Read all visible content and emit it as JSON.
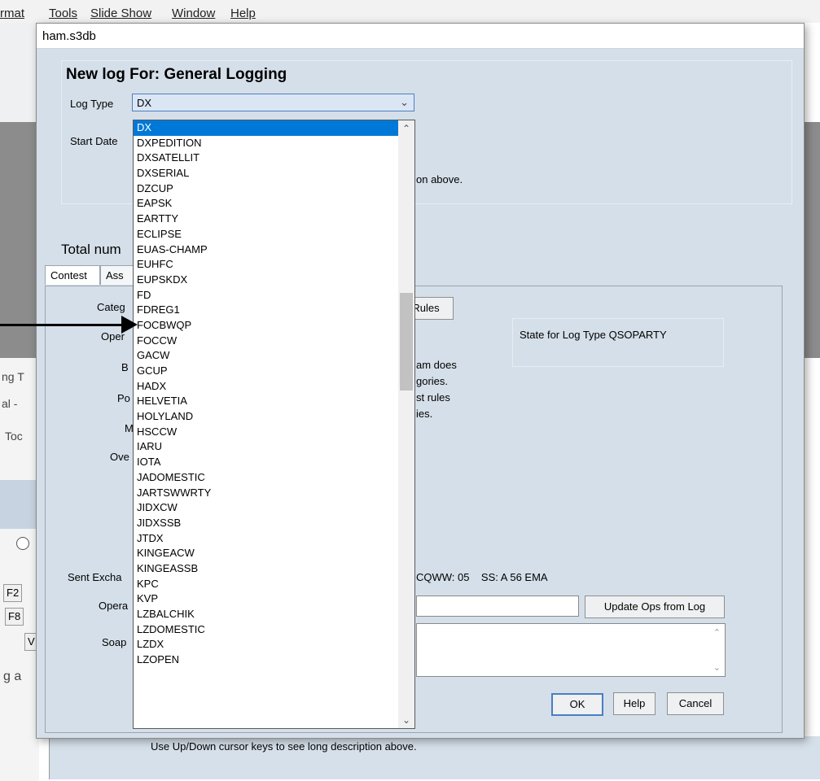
{
  "app_menu": {
    "items": [
      "rmat",
      "Tools",
      "Slide Show",
      "Window",
      "Help"
    ]
  },
  "background": {
    "left_fragments": [
      "ng T",
      "al -",
      "Toc",
      "F2",
      "F8",
      "V",
      "g  a"
    ],
    "bottom_hint": "Use Up/Down cursor keys to see long description above."
  },
  "dialog": {
    "window_title": "ham.s3db",
    "heading": "New log For: General Logging",
    "log_type_label": "Log Type",
    "log_type_value": "DX",
    "start_date_label": "Start Date",
    "description_fragment": "on above.",
    "total_label": "Total num",
    "tabs": [
      "Contest",
      "Ass"
    ],
    "rules_button": "Rules",
    "state_label": "State for Log Type QSOPARTY",
    "field_labels": {
      "category": "Categ",
      "operator": "Oper",
      "band": "B",
      "power": "Po",
      "mode": "M",
      "overlay": "Ove",
      "sent_exchange": "Sent Excha",
      "operators": "Opera",
      "soapbox": "Soap"
    },
    "info_lines": [
      "am does",
      "gories.",
      "st rules",
      "ies."
    ],
    "exchange_examples": "CQWW: 05    SS: A 56 EMA",
    "update_ops_button": "Update Ops from Log",
    "ok_button": "OK",
    "help_button": "Help",
    "cancel_button": "Cancel"
  },
  "dropdown": {
    "selected": "DX",
    "items": [
      "DX",
      "DXPEDITION",
      "DXSATELLIT",
      "DXSERIAL",
      "DZCUP",
      "EAPSK",
      "EARTTY",
      "ECLIPSE",
      "EUAS-CHAMP",
      "EUHFC",
      "EUPSKDX",
      "FD",
      "FDREG1",
      "FOCBWQP",
      "FOCCW",
      "GACW",
      "GCUP",
      "HADX",
      "HELVETIA",
      "HOLYLAND",
      "HSCCW",
      "IARU",
      "IOTA",
      "JADOMESTIC",
      "JARTSWWRTY",
      "JIDXCW",
      "JIDXSSB",
      "JTDX",
      "KINGEACW",
      "KINGEASSB",
      "KPC",
      "KVP",
      "LZBALCHIK",
      "LZDOMESTIC",
      "LZDX",
      "LZOPEN"
    ]
  },
  "colors": {
    "dialog_bg": "#d5dfe9",
    "selection": "#0078d7",
    "accent_border": "#4a7fc2"
  }
}
